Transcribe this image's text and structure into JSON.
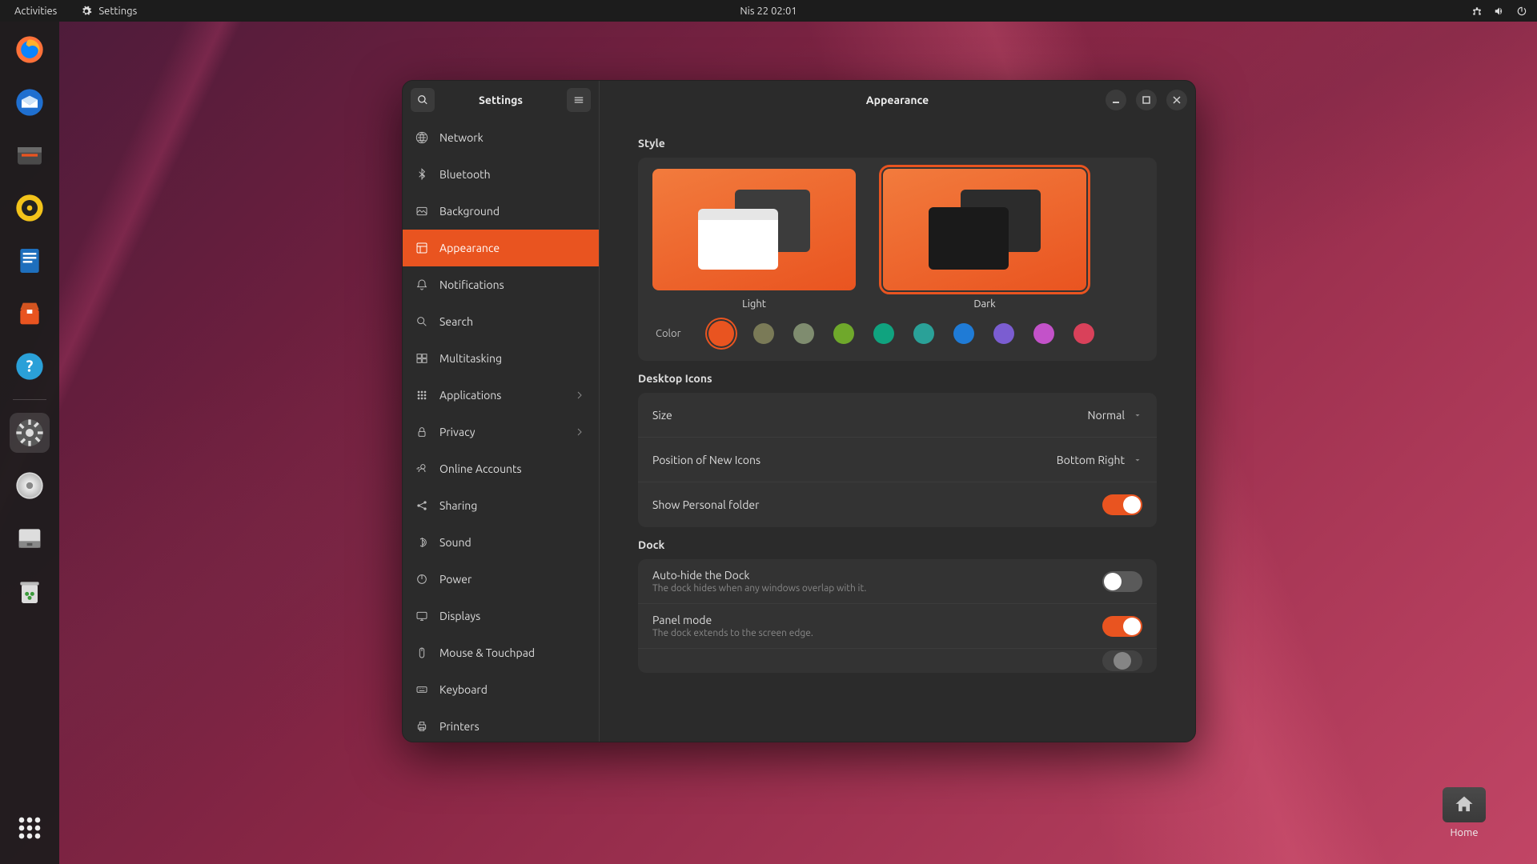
{
  "topbar": {
    "activities": "Activities",
    "app_label": "Settings",
    "clock": "Nis 22  02:01"
  },
  "dock": {
    "items": [
      "firefox",
      "thunderbird",
      "files",
      "rhythmbox",
      "writer",
      "software",
      "help",
      "settings",
      "disc",
      "device",
      "trash"
    ]
  },
  "desktop": {
    "home_label": "Home"
  },
  "sidebar": {
    "title": "Settings",
    "items": [
      {
        "id": "network",
        "label": "Network"
      },
      {
        "id": "bluetooth",
        "label": "Bluetooth"
      },
      {
        "id": "background",
        "label": "Background"
      },
      {
        "id": "appearance",
        "label": "Appearance"
      },
      {
        "id": "notifications",
        "label": "Notifications"
      },
      {
        "id": "search",
        "label": "Search"
      },
      {
        "id": "multitasking",
        "label": "Multitasking"
      },
      {
        "id": "applications",
        "label": "Applications"
      },
      {
        "id": "privacy",
        "label": "Privacy"
      },
      {
        "id": "online-accounts",
        "label": "Online Accounts"
      },
      {
        "id": "sharing",
        "label": "Sharing"
      },
      {
        "id": "sound",
        "label": "Sound"
      },
      {
        "id": "power",
        "label": "Power"
      },
      {
        "id": "displays",
        "label": "Displays"
      },
      {
        "id": "mouse",
        "label": "Mouse & Touchpad"
      },
      {
        "id": "keyboard",
        "label": "Keyboard"
      },
      {
        "id": "printers",
        "label": "Printers"
      }
    ],
    "active": "appearance"
  },
  "pane": {
    "title": "Appearance",
    "style": {
      "section": "Style",
      "light_label": "Light",
      "dark_label": "Dark",
      "selected": "dark",
      "color_label": "Color",
      "colors": [
        "#e95420",
        "#7a7a57",
        "#7f8c6f",
        "#6fa82b",
        "#10a37f",
        "#2aa198",
        "#1f7bd6",
        "#7b5dd1",
        "#c352c9",
        "#d9415a"
      ],
      "color_selected": 0
    },
    "desktop_icons": {
      "section": "Desktop Icons",
      "size_label": "Size",
      "size_value": "Normal",
      "position_label": "Position of New Icons",
      "position_value": "Bottom Right",
      "show_personal_label": "Show Personal folder",
      "show_personal_on": true
    },
    "dock": {
      "section": "Dock",
      "autohide_label": "Auto-hide the Dock",
      "autohide_sub": "The dock hides when any windows overlap with it.",
      "autohide_on": false,
      "panel_label": "Panel mode",
      "panel_sub": "The dock extends to the screen edge.",
      "panel_on": true
    }
  }
}
